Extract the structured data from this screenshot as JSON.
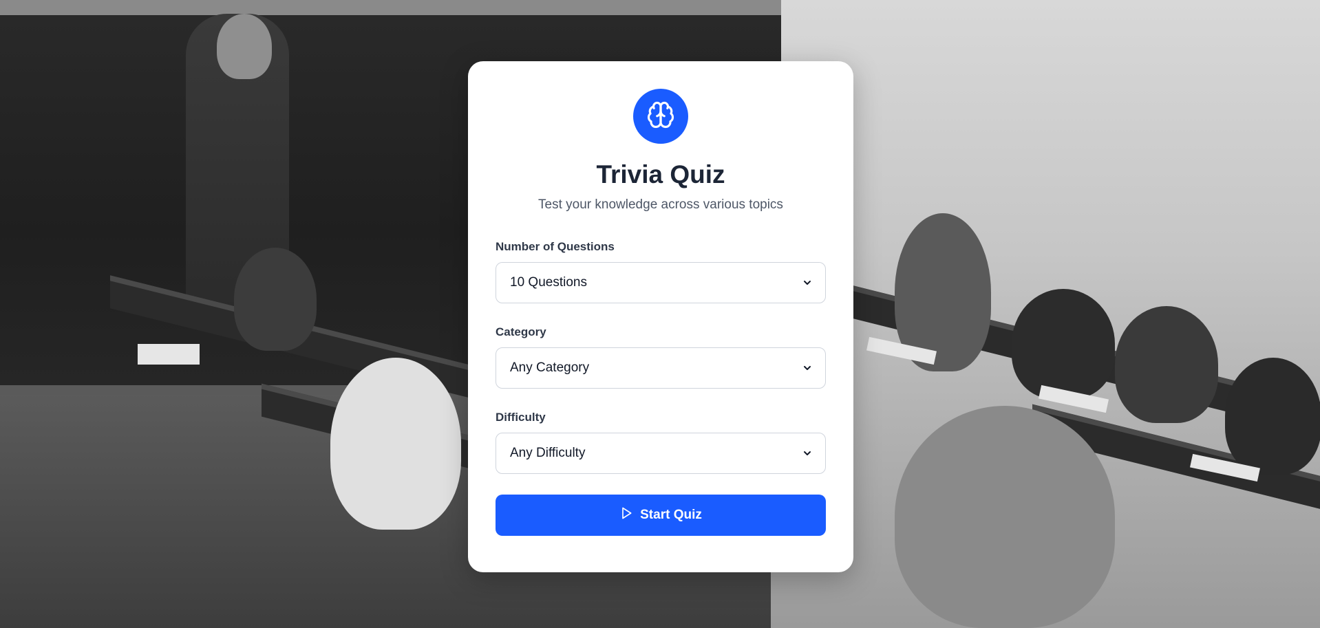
{
  "background": {
    "description_icon": "classroom-photo"
  },
  "card": {
    "logo_icon": "brain-icon",
    "title": "Trivia Quiz",
    "subtitle": "Test your knowledge across various topics"
  },
  "form": {
    "questions": {
      "label": "Number of Questions",
      "value": "10 Questions"
    },
    "category": {
      "label": "Category",
      "value": "Any Category"
    },
    "difficulty": {
      "label": "Difficulty",
      "value": "Any Difficulty"
    }
  },
  "actions": {
    "start_label": "Start Quiz",
    "start_icon": "play-icon"
  },
  "colors": {
    "accent": "#1a5cff",
    "title": "#1c2536",
    "card_bg": "#ffffff"
  }
}
